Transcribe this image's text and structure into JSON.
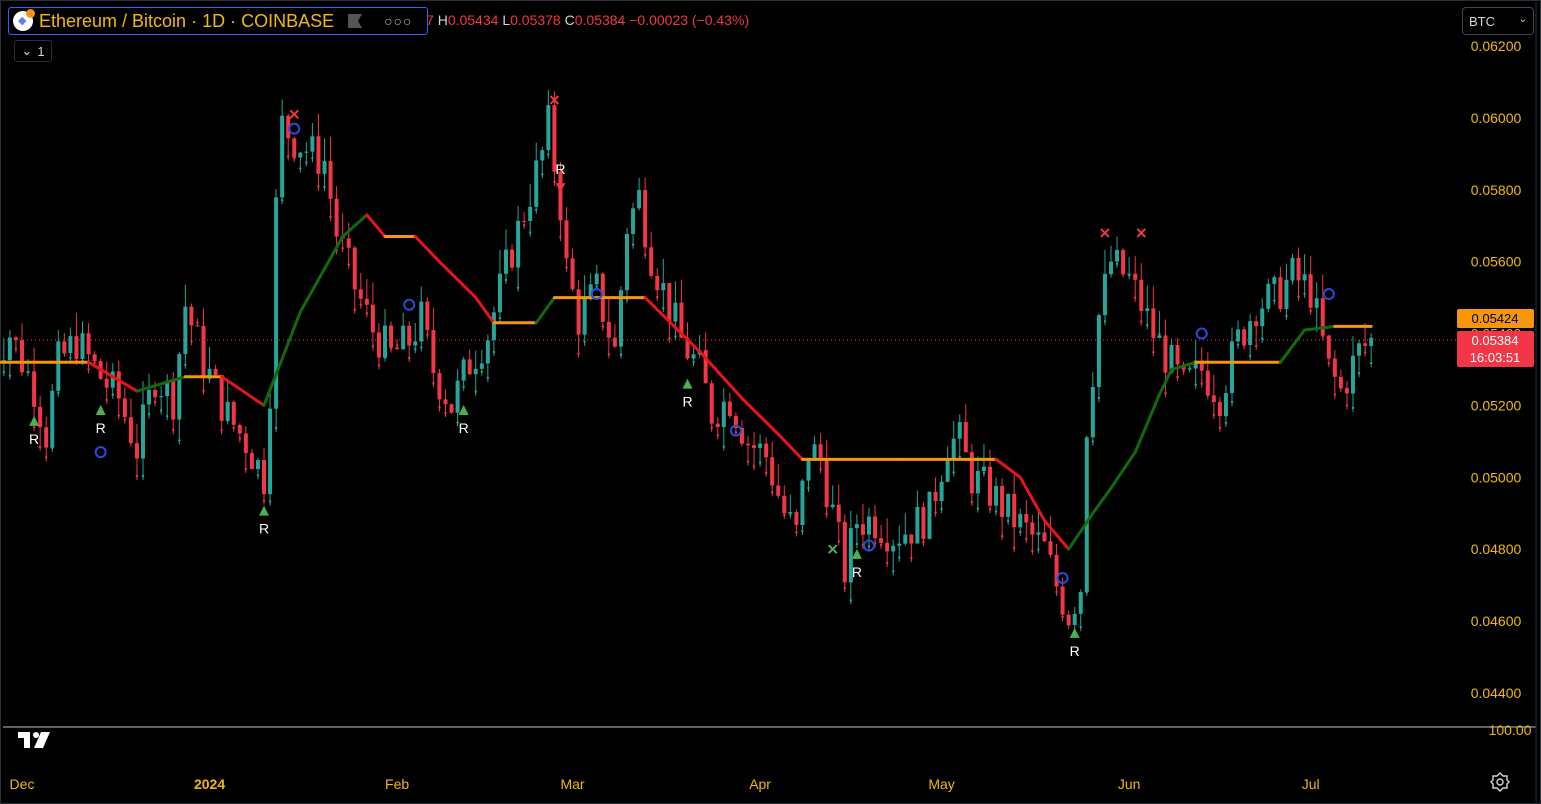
{
  "header": {
    "title": "Ethereum / Bitcoin · 1D · COINBASE",
    "ohlc": {
      "h_label": "H",
      "h": "0.05434",
      "l_label": "L",
      "l": "0.05378",
      "c_label": "C",
      "c": "0.05384",
      "change": "−0.00023 (−0.43%)",
      "clipped_prefix": "7"
    },
    "collapse_count": "1",
    "currency": "BTC"
  },
  "colors": {
    "background": "#000000",
    "up": "#26a69a",
    "down": "#f23645",
    "ma_down": "#e8141b",
    "ma_up": "#116b0a",
    "ma_flat": "#f5960b",
    "axis_text": "#f0b90b"
  },
  "chart_data": {
    "type": "candlestick",
    "symbol": "ETH/BTC",
    "interval": "1D",
    "x_labels": [
      "Dec",
      "2024",
      "Feb",
      "Mar",
      "Apr",
      "May",
      "Jun",
      "Jul"
    ],
    "y_ticks": [
      "0.06200",
      "0.06000",
      "0.05800",
      "0.05600",
      "0.05400",
      "0.05200",
      "0.05000",
      "0.04800",
      "0.04600",
      "0.04400"
    ],
    "ylim": [
      0.0436,
      0.0622
    ],
    "y_bottom_label": "100.00",
    "last_price": "0.05384",
    "countdown": "16:03:51",
    "ma_value": "0.05424",
    "series": [
      {
        "name": "price",
        "points": [
          [
            "2023-11-26",
            0.0533
          ],
          [
            "2023-11-29",
            0.054
          ],
          [
            "2023-12-03",
            0.0525
          ],
          [
            "2023-12-05",
            0.0512
          ],
          [
            "2023-12-07",
            0.0532
          ],
          [
            "2023-12-10",
            0.0538
          ],
          [
            "2023-12-14",
            0.0528
          ],
          [
            "2023-12-17",
            0.0522
          ],
          [
            "2023-12-20",
            0.0508
          ],
          [
            "2023-12-23",
            0.0528
          ],
          [
            "2023-12-26",
            0.0522
          ],
          [
            "2023-12-28",
            0.0548
          ],
          [
            "2023-12-31",
            0.0532
          ],
          [
            "2024-01-04",
            0.0517
          ],
          [
            "2024-01-07",
            0.051
          ],
          [
            "2024-01-10",
            0.05
          ],
          [
            "2024-01-11",
            0.0525
          ],
          [
            "2024-01-12",
            0.0575
          ],
          [
            "2024-01-13",
            0.0598
          ],
          [
            "2024-01-15",
            0.0594
          ],
          [
            "2024-01-18",
            0.059
          ],
          [
            "2024-01-20",
            0.0588
          ],
          [
            "2024-01-22",
            0.0568
          ],
          [
            "2024-01-25",
            0.0553
          ],
          [
            "2024-01-28",
            0.0541
          ],
          [
            "2024-01-31",
            0.0534
          ],
          [
            "2024-02-03",
            0.0538
          ],
          [
            "2024-02-05",
            0.0544
          ],
          [
            "2024-02-07",
            0.053
          ],
          [
            "2024-02-10",
            0.052
          ],
          [
            "2024-02-13",
            0.0532
          ],
          [
            "2024-02-16",
            0.054
          ],
          [
            "2024-02-19",
            0.0558
          ],
          [
            "2024-02-22",
            0.0574
          ],
          [
            "2024-02-25",
            0.059
          ],
          [
            "2024-02-26",
            0.0598
          ],
          [
            "2024-02-28",
            0.0576
          ],
          [
            "2024-02-29",
            0.0558
          ],
          [
            "2024-03-02",
            0.0544
          ],
          [
            "2024-03-05",
            0.0552
          ],
          [
            "2024-03-08",
            0.0535
          ],
          [
            "2024-03-10",
            0.057
          ],
          [
            "2024-03-12",
            0.0578
          ],
          [
            "2024-03-14",
            0.0562
          ],
          [
            "2024-03-16",
            0.0552
          ],
          [
            "2024-03-19",
            0.0538
          ],
          [
            "2024-03-22",
            0.053
          ],
          [
            "2024-03-24",
            0.0518
          ],
          [
            "2024-03-27",
            0.0522
          ],
          [
            "2024-03-30",
            0.051
          ],
          [
            "2024-04-02",
            0.0506
          ],
          [
            "2024-04-05",
            0.049
          ],
          [
            "2024-04-07",
            0.0484
          ],
          [
            "2024-04-09",
            0.0508
          ],
          [
            "2024-04-11",
            0.0505
          ],
          [
            "2024-04-13",
            0.049
          ],
          [
            "2024-04-15",
            0.0474
          ],
          [
            "2024-04-17",
            0.0488
          ],
          [
            "2024-04-20",
            0.0488
          ],
          [
            "2024-04-23",
            0.0484
          ],
          [
            "2024-04-26",
            0.0486
          ],
          [
            "2024-04-29",
            0.049
          ],
          [
            "2024-05-02",
            0.051
          ],
          [
            "2024-05-04",
            0.051
          ],
          [
            "2024-05-06",
            0.05
          ],
          [
            "2024-05-09",
            0.0496
          ],
          [
            "2024-05-12",
            0.049
          ],
          [
            "2024-05-15",
            0.0485
          ],
          [
            "2024-05-18",
            0.048
          ],
          [
            "2024-05-20",
            0.047
          ],
          [
            "2024-05-22",
            0.0462
          ],
          [
            "2024-05-24",
            0.047
          ],
          [
            "2024-05-25",
            0.0515
          ],
          [
            "2024-05-27",
            0.0545
          ],
          [
            "2024-05-29",
            0.056
          ],
          [
            "2024-06-01",
            0.0555
          ],
          [
            "2024-06-03",
            0.0548
          ],
          [
            "2024-06-05",
            0.054
          ],
          [
            "2024-06-07",
            0.0534
          ],
          [
            "2024-06-10",
            0.0525
          ],
          [
            "2024-06-13",
            0.053
          ],
          [
            "2024-06-16",
            0.0523
          ],
          [
            "2024-06-19",
            0.0538
          ],
          [
            "2024-06-22",
            0.0548
          ],
          [
            "2024-06-25",
            0.055
          ],
          [
            "2024-06-28",
            0.0556
          ],
          [
            "2024-07-01",
            0.0552
          ],
          [
            "2024-07-04",
            0.053
          ],
          [
            "2024-07-06",
            0.0524
          ],
          [
            "2024-07-09",
            0.0535
          ],
          [
            "2024-07-11",
            0.0538
          ]
        ]
      },
      {
        "name": "moving-average",
        "points": [
          [
            "2023-11-26",
            0.0532
          ],
          [
            "2023-12-06",
            0.0532
          ],
          [
            "2023-12-12",
            0.0532
          ],
          [
            "2023-12-20",
            0.0524
          ],
          [
            "2023-12-28",
            0.0528
          ],
          [
            "2024-01-03",
            0.0528
          ],
          [
            "2024-01-10",
            0.052
          ],
          [
            "2024-01-16",
            0.0546
          ],
          [
            "2024-01-23",
            0.0567
          ],
          [
            "2024-01-27",
            0.0573
          ],
          [
            "2024-01-30",
            0.0567
          ],
          [
            "2024-02-04",
            0.0567
          ],
          [
            "2024-02-08",
            0.056
          ],
          [
            "2024-02-14",
            0.055
          ],
          [
            "2024-02-17",
            0.0543
          ],
          [
            "2024-02-24",
            0.0543
          ],
          [
            "2024-02-27",
            0.055
          ],
          [
            "2024-03-03",
            0.055
          ],
          [
            "2024-03-08",
            0.055
          ],
          [
            "2024-03-13",
            0.055
          ],
          [
            "2024-03-16",
            0.0545
          ],
          [
            "2024-03-22",
            0.0535
          ],
          [
            "2024-03-29",
            0.0522
          ],
          [
            "2024-04-04",
            0.0512
          ],
          [
            "2024-04-08",
            0.0505
          ],
          [
            "2024-04-14",
            0.0505
          ],
          [
            "2024-04-24",
            0.0505
          ],
          [
            "2024-05-02",
            0.0505
          ],
          [
            "2024-05-10",
            0.0505
          ],
          [
            "2024-05-14",
            0.05
          ],
          [
            "2024-05-18",
            0.0488
          ],
          [
            "2024-05-22",
            0.048
          ],
          [
            "2024-05-26",
            0.049
          ],
          [
            "2024-05-29",
            0.0497
          ],
          [
            "2024-06-02",
            0.0507
          ],
          [
            "2024-06-06",
            0.0523
          ],
          [
            "2024-06-08",
            0.053
          ],
          [
            "2024-06-12",
            0.0532
          ],
          [
            "2024-06-18",
            0.0532
          ],
          [
            "2024-06-26",
            0.0532
          ],
          [
            "2024-06-30",
            0.0541
          ],
          [
            "2024-07-05",
            0.0542
          ],
          [
            "2024-07-11",
            0.0542
          ]
        ]
      }
    ],
    "signal_label": "R",
    "signals_up": [
      "2023-12-03",
      "2023-12-14",
      "2024-01-10",
      "2024-02-12",
      "2024-03-20",
      "2024-04-17",
      "2024-05-23"
    ],
    "signals_down": [
      "2024-02-28"
    ],
    "cross_markers": [
      [
        "2024-01-15",
        0.0601
      ],
      [
        "2024-02-27",
        0.0605
      ],
      [
        "2024-04-13",
        0.048
      ],
      [
        "2024-05-28",
        0.0568
      ],
      [
        "2024-06-03",
        0.0568
      ]
    ],
    "circle_markers": [
      [
        "2023-12-14",
        0.0507
      ],
      [
        "2024-01-15",
        0.0597
      ],
      [
        "2024-02-03",
        0.0548
      ],
      [
        "2024-03-05",
        0.0551
      ],
      [
        "2024-03-28",
        0.0513
      ],
      [
        "2024-04-19",
        0.0481
      ],
      [
        "2024-05-21",
        0.0472
      ],
      [
        "2024-06-13",
        0.054
      ],
      [
        "2024-07-04",
        0.0551
      ]
    ],
    "grid": false
  }
}
